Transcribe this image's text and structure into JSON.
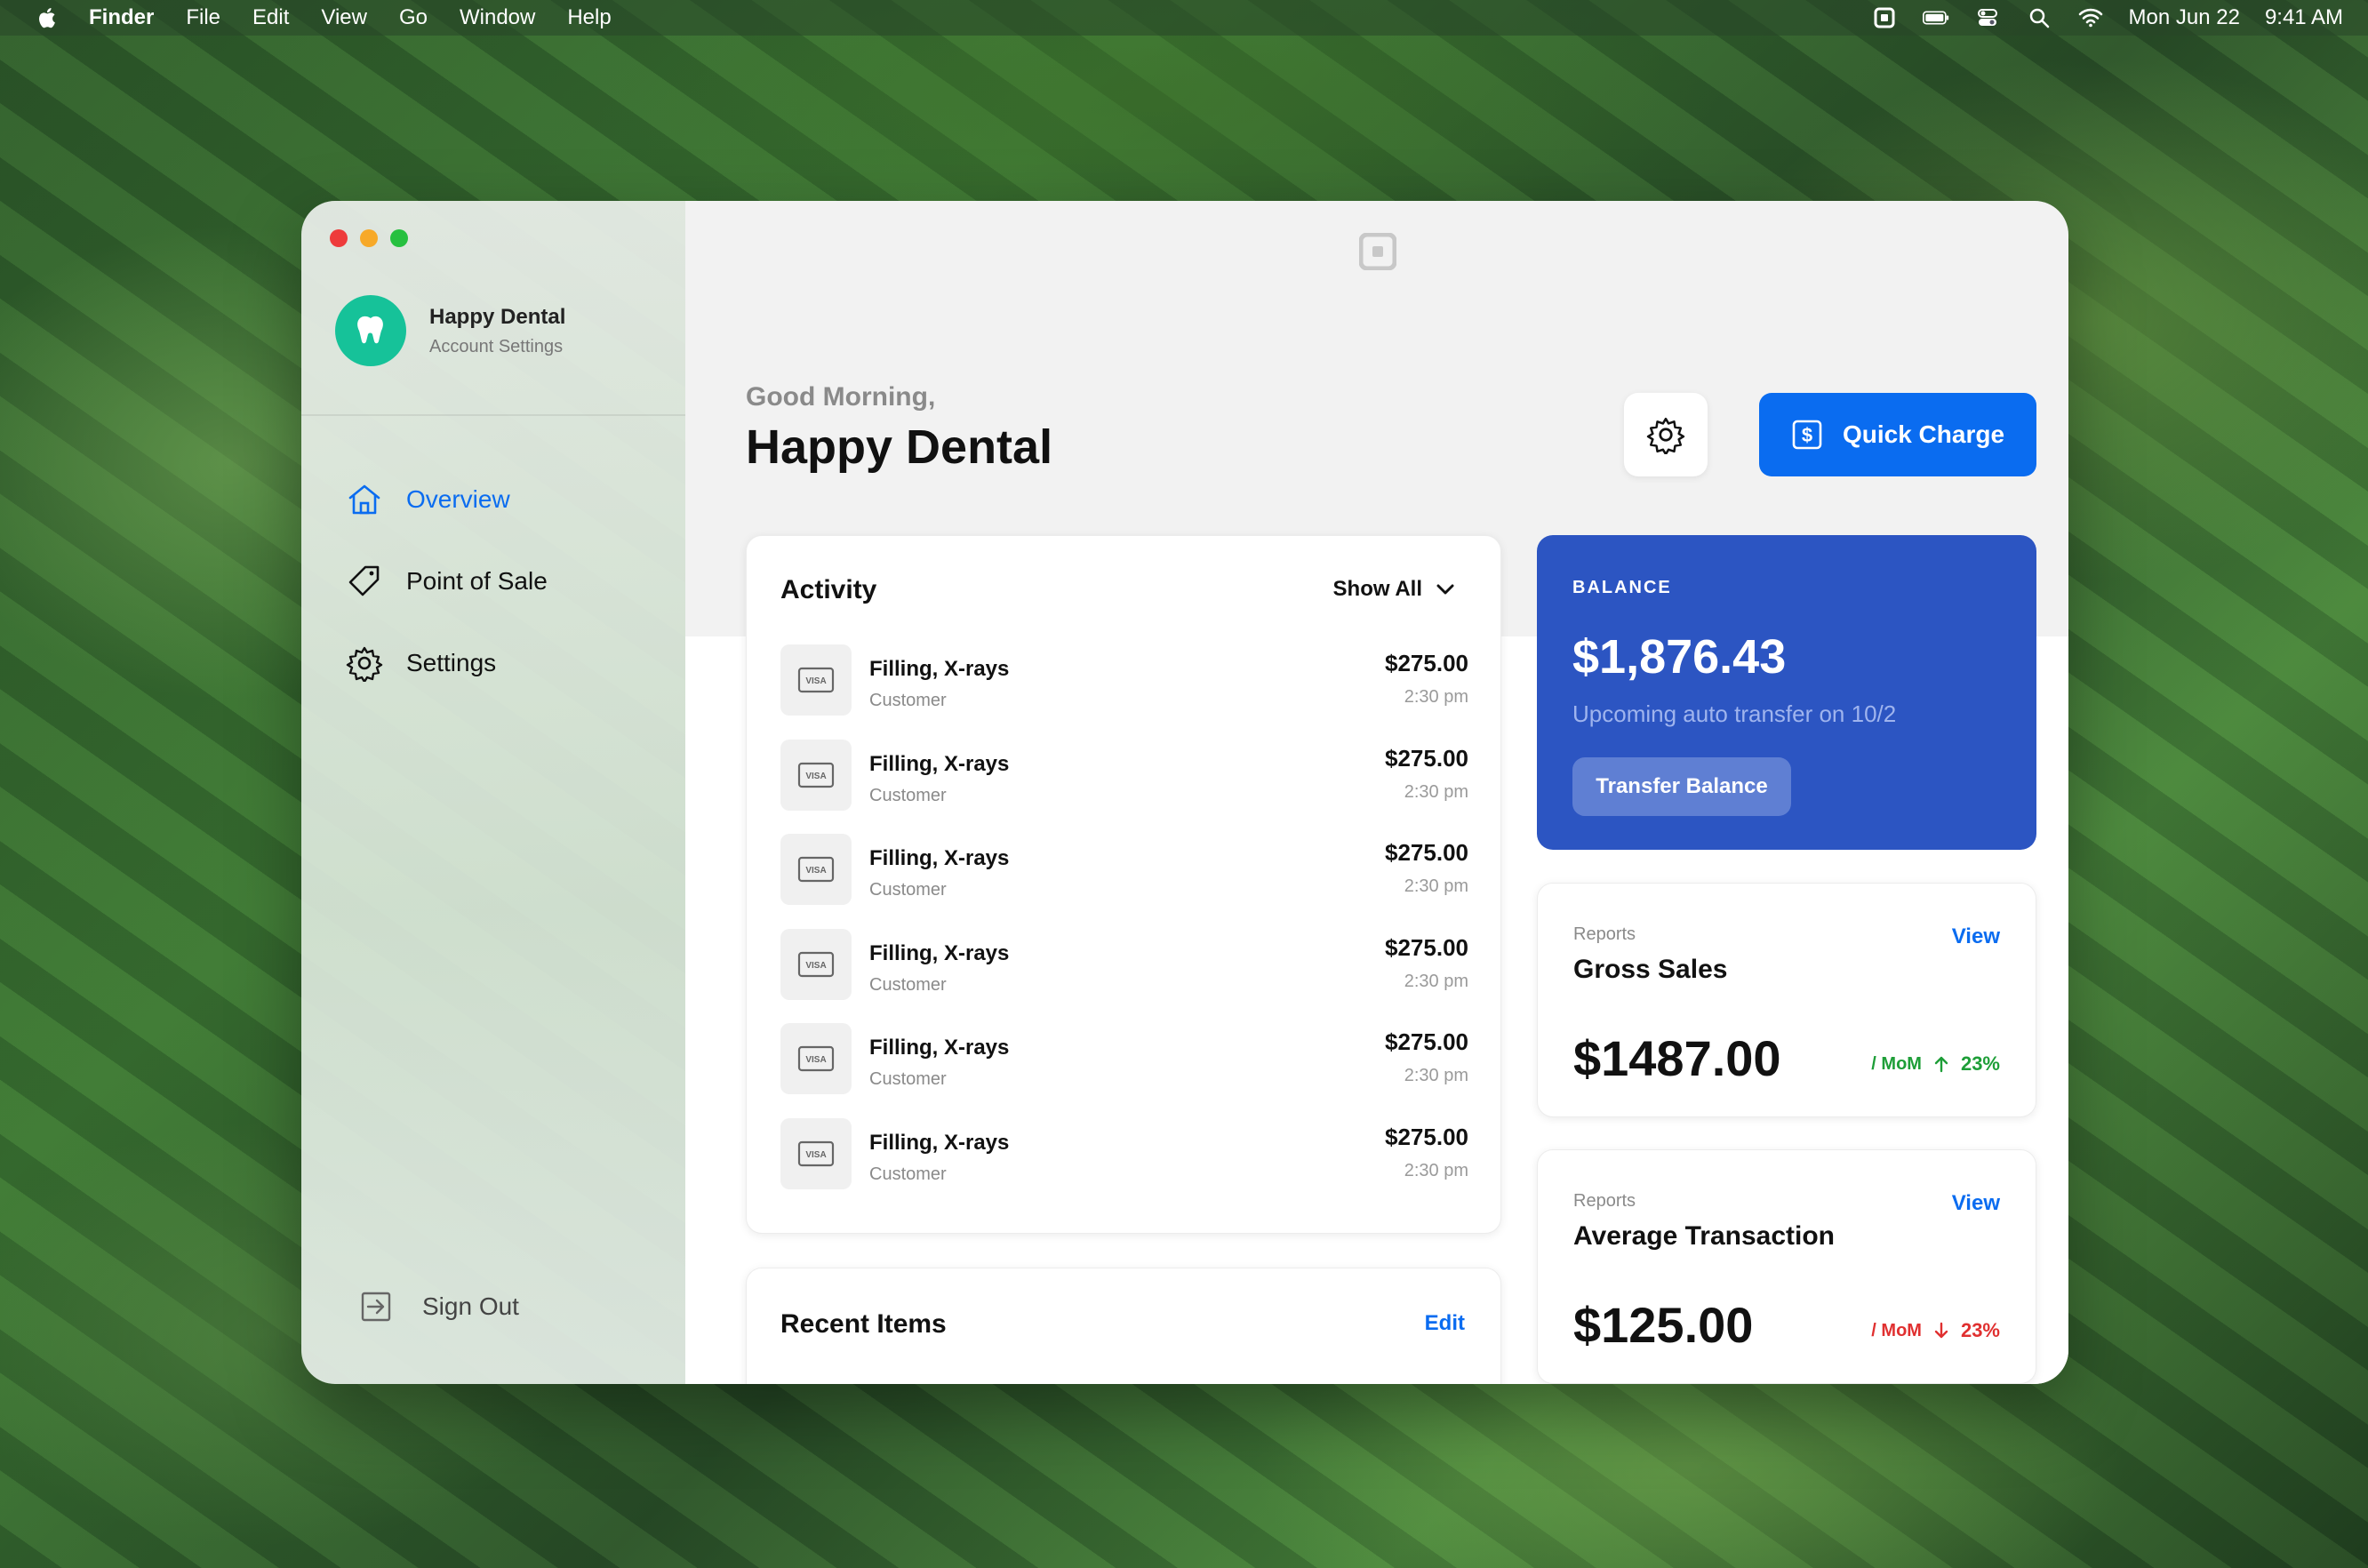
{
  "menubar": {
    "app": "Finder",
    "menus": [
      "File",
      "Edit",
      "View",
      "Go",
      "Window",
      "Help"
    ],
    "date": "Mon Jun 22",
    "time": "9:41 AM"
  },
  "sidebar": {
    "account_name": "Happy Dental",
    "account_sub": "Account Settings",
    "nav": [
      {
        "label": "Overview",
        "icon": "home-icon",
        "active": true
      },
      {
        "label": "Point of Sale",
        "icon": "tag-icon",
        "active": false
      },
      {
        "label": "Settings",
        "icon": "gear-icon",
        "active": false
      }
    ],
    "sign_out": "Sign Out"
  },
  "header": {
    "greeting": "Good Morning,",
    "title": "Happy Dental",
    "quick_charge": "Quick Charge"
  },
  "activity": {
    "title": "Activity",
    "show_all": "Show All",
    "rows": [
      {
        "desc": "Filling, X-rays",
        "who": "Customer",
        "amount": "$275.00",
        "time": "2:30 pm"
      },
      {
        "desc": "Filling, X-rays",
        "who": "Customer",
        "amount": "$275.00",
        "time": "2:30 pm"
      },
      {
        "desc": "Filling, X-rays",
        "who": "Customer",
        "amount": "$275.00",
        "time": "2:30 pm"
      },
      {
        "desc": "Filling, X-rays",
        "who": "Customer",
        "amount": "$275.00",
        "time": "2:30 pm"
      },
      {
        "desc": "Filling, X-rays",
        "who": "Customer",
        "amount": "$275.00",
        "time": "2:30 pm"
      },
      {
        "desc": "Filling, X-rays",
        "who": "Customer",
        "amount": "$275.00",
        "time": "2:30 pm"
      }
    ],
    "card_brand": "VISA"
  },
  "recent": {
    "title": "Recent Items",
    "edit": "Edit"
  },
  "balance": {
    "label": "BALANCE",
    "amount": "$1,876.43",
    "sub": "Upcoming auto transfer on 10/2",
    "button": "Transfer Balance"
  },
  "reports": [
    {
      "kicker": "Reports",
      "name": "Gross Sales",
      "view": "View",
      "value": "$1487.00",
      "mom_label": "/ MoM",
      "mom_pct": "23%",
      "direction": "up"
    },
    {
      "kicker": "Reports",
      "name": "Average Transaction",
      "view": "View",
      "value": "$125.00",
      "mom_label": "/ MoM",
      "mom_pct": "23%",
      "direction": "down"
    }
  ],
  "colors": {
    "accent": "#0a6cf0",
    "balance_bg": "#2c55c2",
    "logo_teal": "#16c299",
    "up_green": "#1e9e38",
    "down_red": "#e03030"
  }
}
